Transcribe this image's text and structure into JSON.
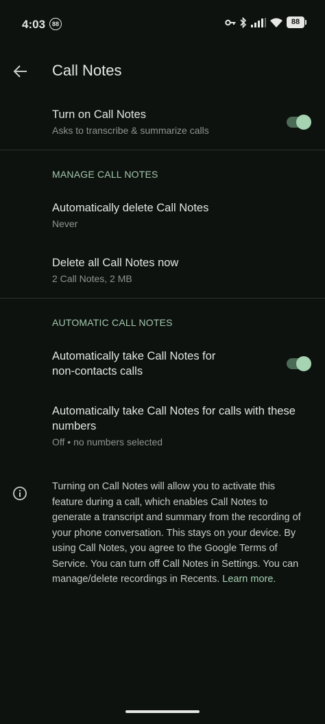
{
  "status_bar": {
    "time": "4:03",
    "left_badge": "88",
    "battery": "88",
    "icons": [
      "key-icon",
      "bluetooth-icon",
      "signal-icon",
      "wifi-icon",
      "battery-icon"
    ]
  },
  "app_bar": {
    "title": "Call Notes",
    "back_icon": "arrow-back-icon"
  },
  "main_toggle": {
    "title": "Turn on Call Notes",
    "subtitle": "Asks to transcribe & summarize calls",
    "enabled": true
  },
  "manage_section": {
    "header": "MANAGE CALL NOTES",
    "items": [
      {
        "title": "Automatically delete Call Notes",
        "subtitle": "Never"
      },
      {
        "title": "Delete all Call Notes now",
        "subtitle": "2 Call Notes, 2 MB"
      }
    ]
  },
  "automatic_section": {
    "header": "AUTOMATIC CALL NOTES",
    "non_contacts": {
      "title_line1": "Automatically take Call Notes for",
      "title_line2": "non-contacts calls",
      "enabled": true
    },
    "numbers": {
      "title_line1": "Automatically take Call Notes for calls with these",
      "title_line2": "numbers",
      "subtitle": "Off • no numbers selected"
    }
  },
  "info": {
    "icon": "info-icon",
    "text": "Turning on Call Notes will allow you to activate this feature during a call, which enables Call Notes to generate a transcript and summary from the recording of your phone conversation. This stays on your device. By using Call Notes, you agree to the Google Terms of Service. You can turn off Call Notes in Settings. You can manage/delete recordings in Recents. ",
    "link": "Learn more."
  },
  "colors": {
    "background": "#0d120f",
    "accent": "#a6d3b1",
    "toggle_track": "#4c6b56",
    "section_header": "#a5c8ad"
  }
}
